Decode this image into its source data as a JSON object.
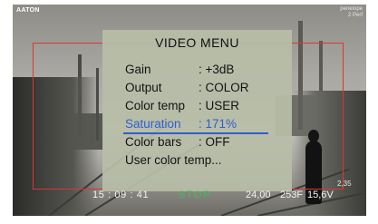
{
  "overlay": {
    "brand": "AATON",
    "camera_model_line1": "penelope",
    "camera_model_line2": "2 Perf"
  },
  "menu": {
    "title": "VIDEO  MENU",
    "items": [
      {
        "label": "Gain",
        "value": ": +3dB"
      },
      {
        "label": "Output",
        "value": ": COLOR"
      },
      {
        "label": "Color temp",
        "value": ": USER"
      },
      {
        "label": "Saturation",
        "value": ": 171%"
      },
      {
        "label": "Color bars",
        "value": ": OFF"
      },
      {
        "label": "User color temp...",
        "value": ""
      }
    ],
    "selected_item": "Saturation",
    "selected_color": "#2e5fd0"
  },
  "status_bar": {
    "timecode": "15 : 09 : 41",
    "state": "STOP",
    "state_color": "#3fbf55",
    "fps": "24,00",
    "footage": "253F",
    "voltage": "15,6V",
    "counter": "2,35"
  },
  "colors": {
    "frame_line": "#d63a32",
    "menu_background": "#b8bda8"
  }
}
